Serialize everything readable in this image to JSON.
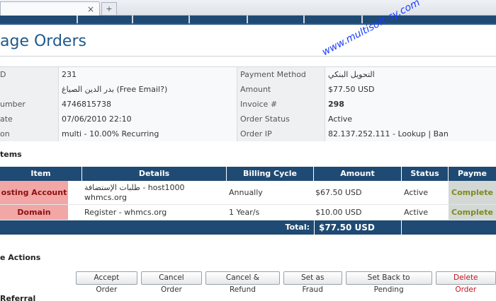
{
  "browser": {
    "tab_close": "×",
    "new_tab": "+"
  },
  "page": {
    "title": "age Orders",
    "watermark": "www.multisoft-sy.com"
  },
  "info": {
    "rows": [
      {
        "label": "D",
        "value": "231",
        "label2": "Payment Method",
        "value2": "التحويل البنكي"
      },
      {
        "label": "",
        "value": "بدر الدين الصياغ (Free Email?)",
        "label2": "Amount",
        "value2": "$77.50 USD"
      },
      {
        "label": "umber",
        "value": "4746815738",
        "label2": "Invoice #",
        "value2": "298"
      },
      {
        "label": "ate",
        "value": "07/06/2010 22:10",
        "label2": "Order Status",
        "value2": "Active"
      },
      {
        "label": "on",
        "value": "multi - 10.00% Recurring",
        "label2": "Order IP",
        "value2": "82.137.252.111"
      }
    ],
    "ip_links": {
      "lookup": "Lookup",
      "separator": "|",
      "ban": "Ban"
    }
  },
  "sections": {
    "items": "tems",
    "actions": "e Actions",
    "referral": "Referral"
  },
  "items_table": {
    "headers": [
      "Item",
      "Details",
      "Billing Cycle",
      "Amount",
      "Status",
      "Payme"
    ],
    "rows": [
      {
        "item": "osting Account",
        "details_line1": "طلبات الإستضافة - host1000",
        "details_line2": "whmcs.org",
        "cycle": "Annually",
        "amount": "$67.50 USD",
        "status": "Active",
        "payment": "Complete"
      },
      {
        "item": "Domain",
        "details_line1": "Register - whmcs.org",
        "details_line2": "",
        "cycle": "1 Year/s",
        "amount": "$10.00 USD",
        "status": "Active",
        "payment": "Complete"
      }
    ],
    "total_label": "Total:",
    "total_value": "$77.50 USD"
  },
  "actions": {
    "accept": "Accept Order",
    "cancel": "Cancel Order",
    "cancel_refund": "Cancel & Refund",
    "fraud": "Set as Fraud",
    "pending": "Set Back to Pending",
    "delete": "Delete Order"
  },
  "colors": {
    "header": "#1f4a73",
    "item_badge": "#f2a6a6",
    "delete_text": "#c0141b"
  }
}
